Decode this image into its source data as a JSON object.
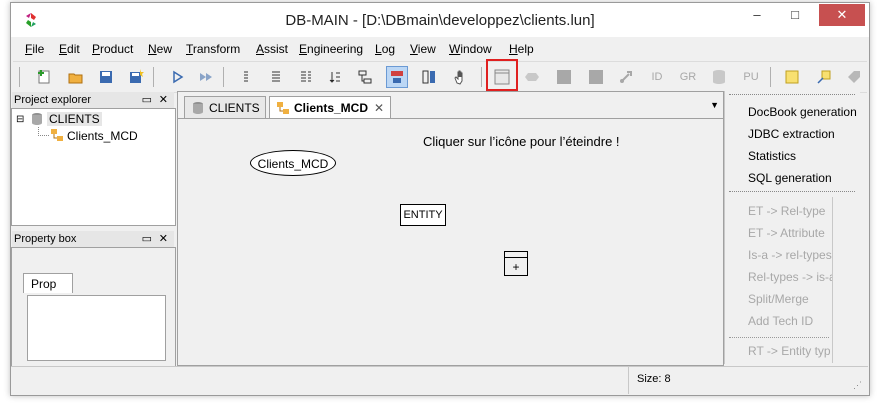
{
  "window": {
    "title": "DB-MAIN  -  [D:\\DBmain\\developpez\\clients.lun]",
    "minimize": "–",
    "maximize": "□",
    "close": "✕"
  },
  "menu": [
    {
      "label": "File"
    },
    {
      "label": "Edit"
    },
    {
      "label": "Product"
    },
    {
      "label": "New"
    },
    {
      "label": "Transform"
    },
    {
      "label": "Assist"
    },
    {
      "label": "Engineering"
    },
    {
      "label": "Log"
    },
    {
      "label": "View"
    },
    {
      "label": "Window"
    },
    {
      "label": "Help"
    }
  ],
  "toolbar": {
    "id_label": "ID",
    "gr_label": "GR",
    "pu_label": "PU"
  },
  "explorer": {
    "title": "Project explorer",
    "root": "CLIENTS",
    "child": "Clients_MCD"
  },
  "propbox": {
    "title": "Property box",
    "tab": "Prop"
  },
  "editor": {
    "tabs": [
      {
        "label": "CLIENTS"
      },
      {
        "label": "Clients_MCD"
      }
    ],
    "schema_label": "Clients_MCD",
    "entity_label": "ENTITY",
    "annotation": "Cliquer sur l’icône pour l’éteindre !",
    "cross": "+"
  },
  "rightpanel": {
    "generators": [
      "DocBook generation",
      "JDBC extraction",
      "Statistics",
      "SQL generation"
    ],
    "transforms": [
      "ET -> Rel-type",
      "ET -> Attribute",
      "Is-a -> rel-types",
      "Rel-types -> is-a",
      "Split/Merge",
      "Add Tech ID"
    ],
    "last": "RT -> Entity typ"
  },
  "status": {
    "size": "Size: 8"
  },
  "colors": {
    "highlight": "#e02020",
    "selected_tool": "#bcd7f5",
    "close_button": "#c75050"
  }
}
